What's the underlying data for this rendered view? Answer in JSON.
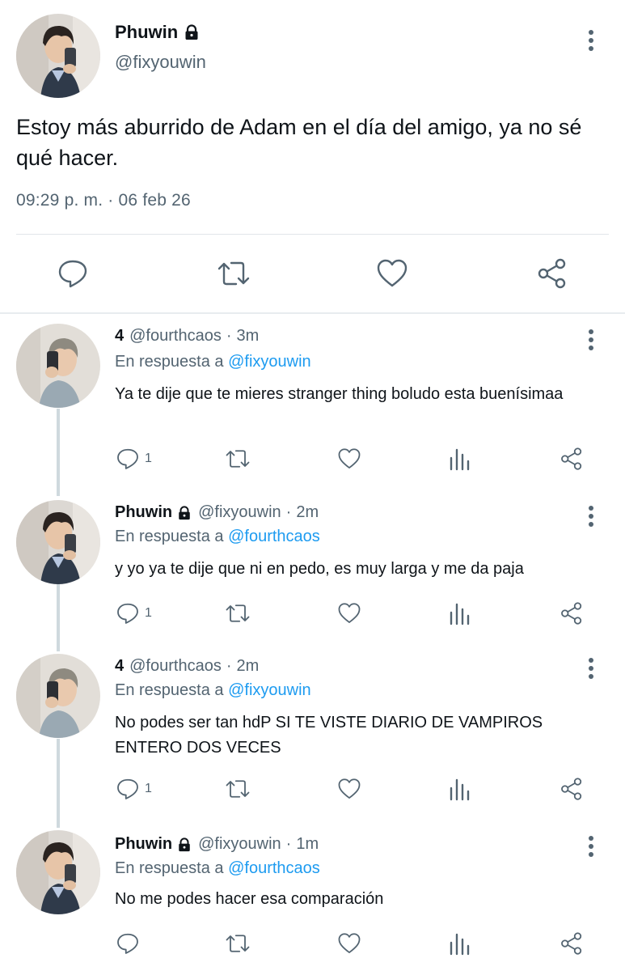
{
  "main_tweet": {
    "author_name": "Phuwin",
    "author_handle": "@fixyouwin",
    "author_locked": true,
    "text": "Estoy más aburrido de Adam en el día del amigo, ya no sé qué hacer.",
    "timestamp": "09:29 p. m. · 06 feb 26",
    "actions": [
      "reply-icon",
      "retweet-icon",
      "like-icon",
      "share-icon"
    ]
  },
  "replies": [
    {
      "name": "4",
      "handle": "@fourthcaos",
      "locked": false,
      "time": "3m",
      "reply_prefix": "En respuesta a",
      "reply_to": "@fixyouwin",
      "text": "Ya te dije que te mieres stranger thing boludo esta buenísimaa",
      "reply_count": "1"
    },
    {
      "name": "Phuwin",
      "handle": "@fixyouwin",
      "locked": true,
      "time": "2m",
      "reply_prefix": "En respuesta a",
      "reply_to": "@fourthcaos",
      "text": "y yo ya te dije que ni en pedo, es muy larga y me da paja",
      "reply_count": "1"
    },
    {
      "name": "4",
      "handle": "@fourthcaos",
      "locked": false,
      "time": "2m",
      "reply_prefix": "En respuesta a",
      "reply_to": "@fixyouwin",
      "text": "No podes ser tan hdP SI TE VISTE DIARIO DE VAMPIROS ENTERO DOS VECES",
      "reply_count": "1"
    },
    {
      "name": "Phuwin",
      "handle": "@fixyouwin",
      "locked": true,
      "time": "1m",
      "reply_prefix": "En respuesta a",
      "reply_to": "@fourthcaos",
      "text": "No me podes hacer esa comparación",
      "reply_count": ""
    }
  ],
  "separator": "·",
  "colors": {
    "text": "#0f1419",
    "secondary": "#536471",
    "link": "#1d9bf0",
    "thread_line": "#cfd9de",
    "divider": "#e1e6ea"
  }
}
